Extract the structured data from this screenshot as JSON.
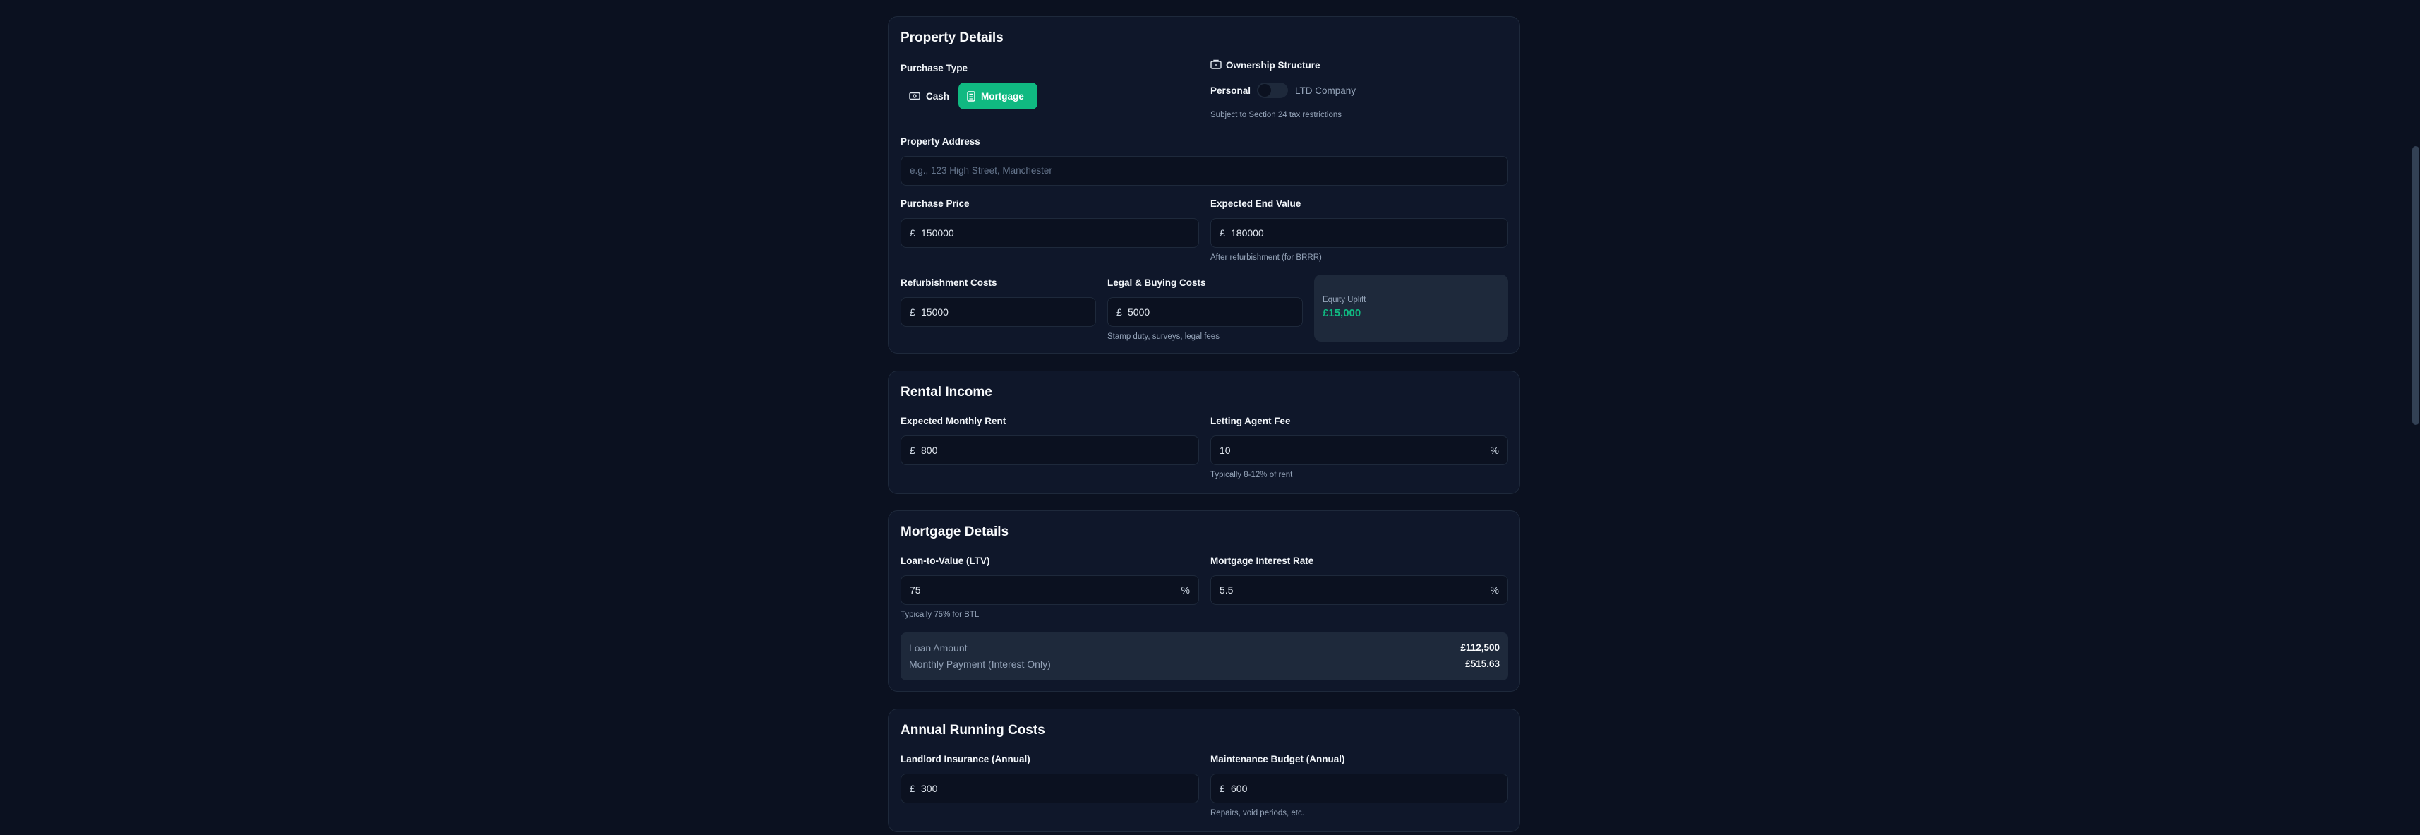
{
  "property": {
    "title": "Property Details",
    "purchase_type_label": "Purchase Type",
    "cash_label": "Cash",
    "mortgage_label": "Mortgage",
    "ownership_label": "Ownership Structure",
    "personal_label": "Personal",
    "ltd_label": "LTD Company",
    "ownership_hint": "Subject to Section 24 tax restrictions",
    "address_label": "Property Address",
    "address_placeholder": "e.g., 123 High Street, Manchester",
    "purchase_price_label": "Purchase Price",
    "purchase_price_value": "150000",
    "end_value_label": "Expected End Value",
    "end_value_value": "180000",
    "end_value_hint": "After refurbishment (for BRRR)",
    "refurb_label": "Refurbishment Costs",
    "refurb_value": "15000",
    "legal_label": "Legal & Buying Costs",
    "legal_value": "5000",
    "legal_hint": "Stamp duty, surveys, legal fees",
    "uplift_label": "Equity Uplift",
    "uplift_value": "£15,000",
    "currency": "£"
  },
  "rental": {
    "title": "Rental Income",
    "rent_label": "Expected Monthly Rent",
    "rent_value": "800",
    "agent_fee_label": "Letting Agent Fee",
    "agent_fee_value": "10",
    "agent_fee_unit": "%",
    "agent_fee_hint": "Typically 8-12% of rent"
  },
  "mortgage": {
    "title": "Mortgage Details",
    "ltv_label": "Loan-to-Value (LTV)",
    "ltv_value": "75",
    "ltv_unit": "%",
    "ltv_hint": "Typically 75% for BTL",
    "rate_label": "Mortgage Interest Rate",
    "rate_value": "5.5",
    "rate_unit": "%",
    "loan_amount_label": "Loan Amount",
    "loan_amount_value": "£112,500",
    "monthly_payment_label": "Monthly Payment (Interest Only)",
    "monthly_payment_value": "£515.63"
  },
  "running": {
    "title": "Annual Running Costs",
    "insurance_label": "Landlord Insurance (Annual)",
    "insurance_value": "300",
    "maintenance_label": "Maintenance Budget (Annual)",
    "maintenance_value": "600",
    "maintenance_hint": "Repairs, void periods, etc."
  },
  "colors": {
    "accent": "#10b981",
    "background": "#0b1120",
    "card": "#0f172a"
  },
  "icons": [
    "banknote-icon",
    "calculator-icon",
    "building-icon"
  ]
}
